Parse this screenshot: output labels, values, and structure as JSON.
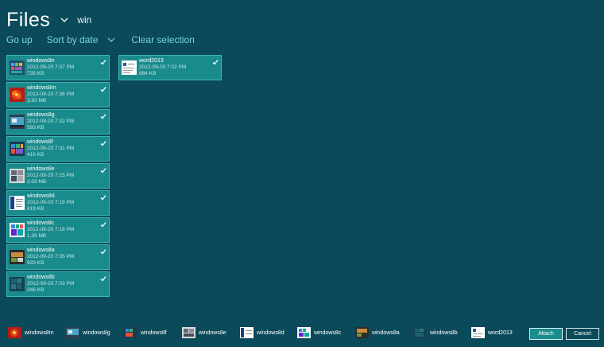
{
  "header": {
    "title": "Files",
    "query": "win"
  },
  "commands": {
    "go_up": "Go up",
    "sort": "Sort by date",
    "clear": "Clear selection"
  },
  "files": [
    {
      "name": "windows9n",
      "date": "2012-09-20 7:37 PM",
      "size": "735 KB",
      "thumb": "tiles-icon"
    },
    {
      "name": "windows8m",
      "date": "2012-09-20 7:36 PM",
      "size": "3.93 MB",
      "thumb": "red-flower-icon"
    },
    {
      "name": "windows8g",
      "date": "2012-09-20 7:32 PM",
      "size": "593 KB",
      "thumb": "desktop-icon"
    },
    {
      "name": "windows8f",
      "date": "2012-09-20 7:31 PM",
      "size": "416 KB",
      "thumb": "tiles-icon"
    },
    {
      "name": "windows8e",
      "date": "2012-09-20 7:25 PM",
      "size": "2.03 MB",
      "thumb": "gallery-icon"
    },
    {
      "name": "windows8d",
      "date": "2012-09-20 7:18 PM",
      "size": "619 KB",
      "thumb": "document-icon"
    },
    {
      "name": "windows8c",
      "date": "2012-09-20 7:16 PM",
      "size": "1.39 MB",
      "thumb": "colorful-tiles-icon"
    },
    {
      "name": "windows8a",
      "date": "2012-09-20 7:05 PM",
      "size": "933 KB",
      "thumb": "media-icon"
    },
    {
      "name": "windows8b",
      "date": "2012-09-20 7:03 PM",
      "size": "346 KB",
      "thumb": "dark-tiles-icon"
    },
    {
      "name": "word2013",
      "date": "2012-09-20 7:02 PM",
      "size": "684 KB",
      "thumb": "word-document-icon"
    }
  ],
  "basket": [
    "windows8m",
    "windows8g",
    "windows8f",
    "windows8e",
    "windows8d",
    "windows8c",
    "windows8a",
    "windows8b",
    "word2013"
  ],
  "buttons": {
    "attach": "Attach",
    "cancel": "Cancel"
  },
  "colors": {
    "background": "#0b4a5a",
    "tile": "#1a8b8c",
    "accent": "#79d4dd"
  }
}
